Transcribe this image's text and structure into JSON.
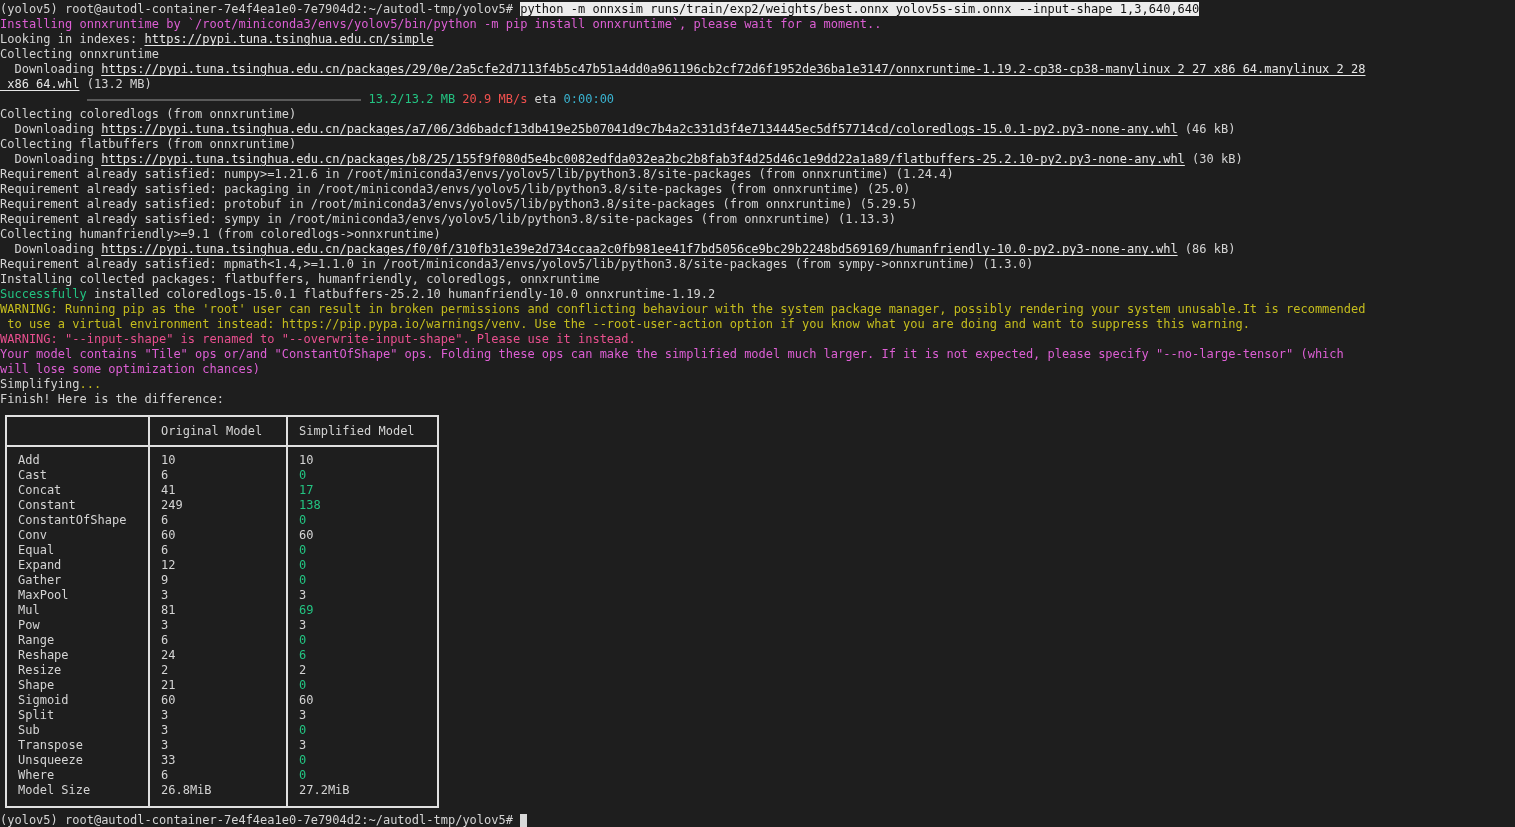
{
  "lines": [
    [
      {
        "kind": "text",
        "text": "(yolov5) root@autodl-container-7e4f4ea1e0-7e7904d2:~/autodl-tmp/yolov5# "
      },
      {
        "kind": "command",
        "text": "python -m onnxsim runs/train/exp2/weights/best.onnx yolov5s-sim.onnx --input-shape 1,3,640,640"
      }
    ],
    [
      {
        "kind": "magenta",
        "text": "Installing onnxruntime by `/root/miniconda3/envs/yolov5/bin/python -m pip install onnxruntime`, please wait for a moment.."
      }
    ],
    [
      {
        "kind": "text",
        "text": "Looking in indexes: "
      },
      {
        "kind": "link",
        "text": "https://pypi.tuna.tsinghua.edu.cn/simple"
      }
    ],
    [
      {
        "kind": "text",
        "text": "Collecting onnxruntime"
      }
    ],
    [
      {
        "kind": "text",
        "text": "  Downloading "
      },
      {
        "kind": "link",
        "text": "https://pypi.tuna.tsinghua.edu.cn/packages/29/0e/2a5cfe2d7113f4b5c47b51a4dd0a961196cb2cf72d6f1952de36ba1e3147/onnxruntime-1.19.2-cp38-cp38-manylinux_2_27_x86_64.manylinux_2_28"
      }
    ],
    [
      {
        "kind": "link",
        "text": "_x86_64.whl"
      },
      {
        "kind": "text",
        "text": " (13.2 MB)"
      }
    ],
    [
      {
        "kind": "bar",
        "level": 1
      },
      {
        "kind": "green",
        "text": " 13.2/13.2 MB"
      },
      {
        "kind": "red",
        "text": " 20.9 MB/s"
      },
      {
        "kind": "text",
        "text": " eta "
      },
      {
        "kind": "cyan",
        "text": "0:00:00"
      }
    ],
    [
      {
        "kind": "text",
        "text": "Collecting coloredlogs (from onnxruntime)"
      }
    ],
    [
      {
        "kind": "text",
        "text": "  Downloading "
      },
      {
        "kind": "link",
        "text": "https://pypi.tuna.tsinghua.edu.cn/packages/a7/06/3d6badcf13db419e25b07041d9c7b4a2c331d3f4e7134445ec5df57714cd/coloredlogs-15.0.1-py2.py3-none-any.whl"
      },
      {
        "kind": "text",
        "text": " (46 kB)"
      }
    ],
    [
      {
        "kind": "text",
        "text": "Collecting flatbuffers (from onnxruntime)"
      }
    ],
    [
      {
        "kind": "text",
        "text": "  Downloading "
      },
      {
        "kind": "link",
        "text": "https://pypi.tuna.tsinghua.edu.cn/packages/b8/25/155f9f080d5e4bc0082edfda032ea2bc2b8fab3f4d25d46c1e9dd22a1a89/flatbuffers-25.2.10-py2.py3-none-any.whl"
      },
      {
        "kind": "text",
        "text": " (30 kB)"
      }
    ],
    [
      {
        "kind": "text",
        "text": "Requirement already satisfied: numpy>=1.21.6 in /root/miniconda3/envs/yolov5/lib/python3.8/site-packages (from onnxruntime) (1.24.4)"
      }
    ],
    [
      {
        "kind": "text",
        "text": "Requirement already satisfied: packaging in /root/miniconda3/envs/yolov5/lib/python3.8/site-packages (from onnxruntime) (25.0)"
      }
    ],
    [
      {
        "kind": "text",
        "text": "Requirement already satisfied: protobuf in /root/miniconda3/envs/yolov5/lib/python3.8/site-packages (from onnxruntime) (5.29.5)"
      }
    ],
    [
      {
        "kind": "text",
        "text": "Requirement already satisfied: sympy in /root/miniconda3/envs/yolov5/lib/python3.8/site-packages (from onnxruntime) (1.13.3)"
      }
    ],
    [
      {
        "kind": "text",
        "text": "Collecting humanfriendly>=9.1 (from coloredlogs->onnxruntime)"
      }
    ],
    [
      {
        "kind": "text",
        "text": "  Downloading "
      },
      {
        "kind": "link",
        "text": "https://pypi.tuna.tsinghua.edu.cn/packages/f0/0f/310fb31e39e2d734ccaa2c0fb981ee41f7bd5056ce9bc29b2248bd569169/humanfriendly-10.0-py2.py3-none-any.whl"
      },
      {
        "kind": "text",
        "text": " (86 kB)"
      }
    ],
    [
      {
        "kind": "text",
        "text": "Requirement already satisfied: mpmath<1.4,>=1.1.0 in /root/miniconda3/envs/yolov5/lib/python3.8/site-packages (from sympy->onnxruntime) (1.3.0)"
      }
    ],
    [
      {
        "kind": "text",
        "text": "Installing collected packages: flatbuffers, humanfriendly, coloredlogs, onnxruntime"
      }
    ],
    [
      {
        "kind": "green",
        "text": "Successfully"
      },
      {
        "kind": "text",
        "text": " installed coloredlogs-15.0.1 flatbuffers-25.2.10 humanfriendly-10.0 onnxruntime-1.19.2"
      }
    ],
    [
      {
        "kind": "yellow",
        "text": "WARNING: Running pip as the 'root' user can result in broken permissions and conflicting behaviour with the system package manager, possibly rendering your system unusable.It is recommended"
      }
    ],
    [
      {
        "kind": "yellow",
        "text": " to use a virtual environment instead: https://pip.pypa.io/warnings/venv. Use the --root-user-action option if you know what you are doing and want to suppress this warning."
      }
    ],
    [
      {
        "kind": "pink",
        "text": "WARNING: \"--input-shape\" is renamed to \"--overwrite-input-shape\". Please use it instead."
      }
    ],
    [
      {
        "kind": "magenta",
        "text": "Your model contains \"Tile\" ops or/and \"ConstantOfShape\" ops. Folding these ops can make the simplified model much larger. If it is not expected, please specify \"--no-large-tensor\" (which"
      }
    ],
    [
      {
        "kind": "magenta",
        "text": "will lose some optimization chances)"
      }
    ],
    [
      {
        "kind": "text",
        "text": "Simplifying"
      },
      {
        "kind": "yellow",
        "text": "..."
      }
    ],
    [
      {
        "kind": "text",
        "text": "Finish! Here is the difference:"
      }
    ]
  ],
  "table": {
    "columns": [
      "Original Model",
      "Simplified Model"
    ],
    "rows": [
      {
        "op": "Add",
        "original": "10",
        "simplified": "10",
        "changed": false
      },
      {
        "op": "Cast",
        "original": "6",
        "simplified": "0",
        "changed": true
      },
      {
        "op": "Concat",
        "original": "41",
        "simplified": "17",
        "changed": true
      },
      {
        "op": "Constant",
        "original": "249",
        "simplified": "138",
        "changed": true
      },
      {
        "op": "ConstantOfShape",
        "original": "6",
        "simplified": "0",
        "changed": true
      },
      {
        "op": "Conv",
        "original": "60",
        "simplified": "60",
        "changed": false
      },
      {
        "op": "Equal",
        "original": "6",
        "simplified": "0",
        "changed": true
      },
      {
        "op": "Expand",
        "original": "12",
        "simplified": "0",
        "changed": true
      },
      {
        "op": "Gather",
        "original": "9",
        "simplified": "0",
        "changed": true
      },
      {
        "op": "MaxPool",
        "original": "3",
        "simplified": "3",
        "changed": false
      },
      {
        "op": "Mul",
        "original": "81",
        "simplified": "69",
        "changed": true
      },
      {
        "op": "Pow",
        "original": "3",
        "simplified": "3",
        "changed": false
      },
      {
        "op": "Range",
        "original": "6",
        "simplified": "0",
        "changed": true
      },
      {
        "op": "Reshape",
        "original": "24",
        "simplified": "6",
        "changed": true
      },
      {
        "op": "Resize",
        "original": "2",
        "simplified": "2",
        "changed": false
      },
      {
        "op": "Shape",
        "original": "21",
        "simplified": "0",
        "changed": true
      },
      {
        "op": "Sigmoid",
        "original": "60",
        "simplified": "60",
        "changed": false
      },
      {
        "op": "Split",
        "original": "3",
        "simplified": "3",
        "changed": false
      },
      {
        "op": "Sub",
        "original": "3",
        "simplified": "0",
        "changed": true
      },
      {
        "op": "Transpose",
        "original": "3",
        "simplified": "3",
        "changed": false
      },
      {
        "op": "Unsqueeze",
        "original": "33",
        "simplified": "0",
        "changed": true
      },
      {
        "op": "Where",
        "original": "6",
        "simplified": "0",
        "changed": true
      },
      {
        "op": "Model Size",
        "original": "26.8MiB",
        "simplified": "27.2MiB",
        "changed": false
      }
    ]
  },
  "prompt": {
    "text": "(yolov5) root@autodl-container-7e4f4ea1e0-7e7904d2:~/autodl-tmp/yolov5# ",
    "cursor": true
  }
}
